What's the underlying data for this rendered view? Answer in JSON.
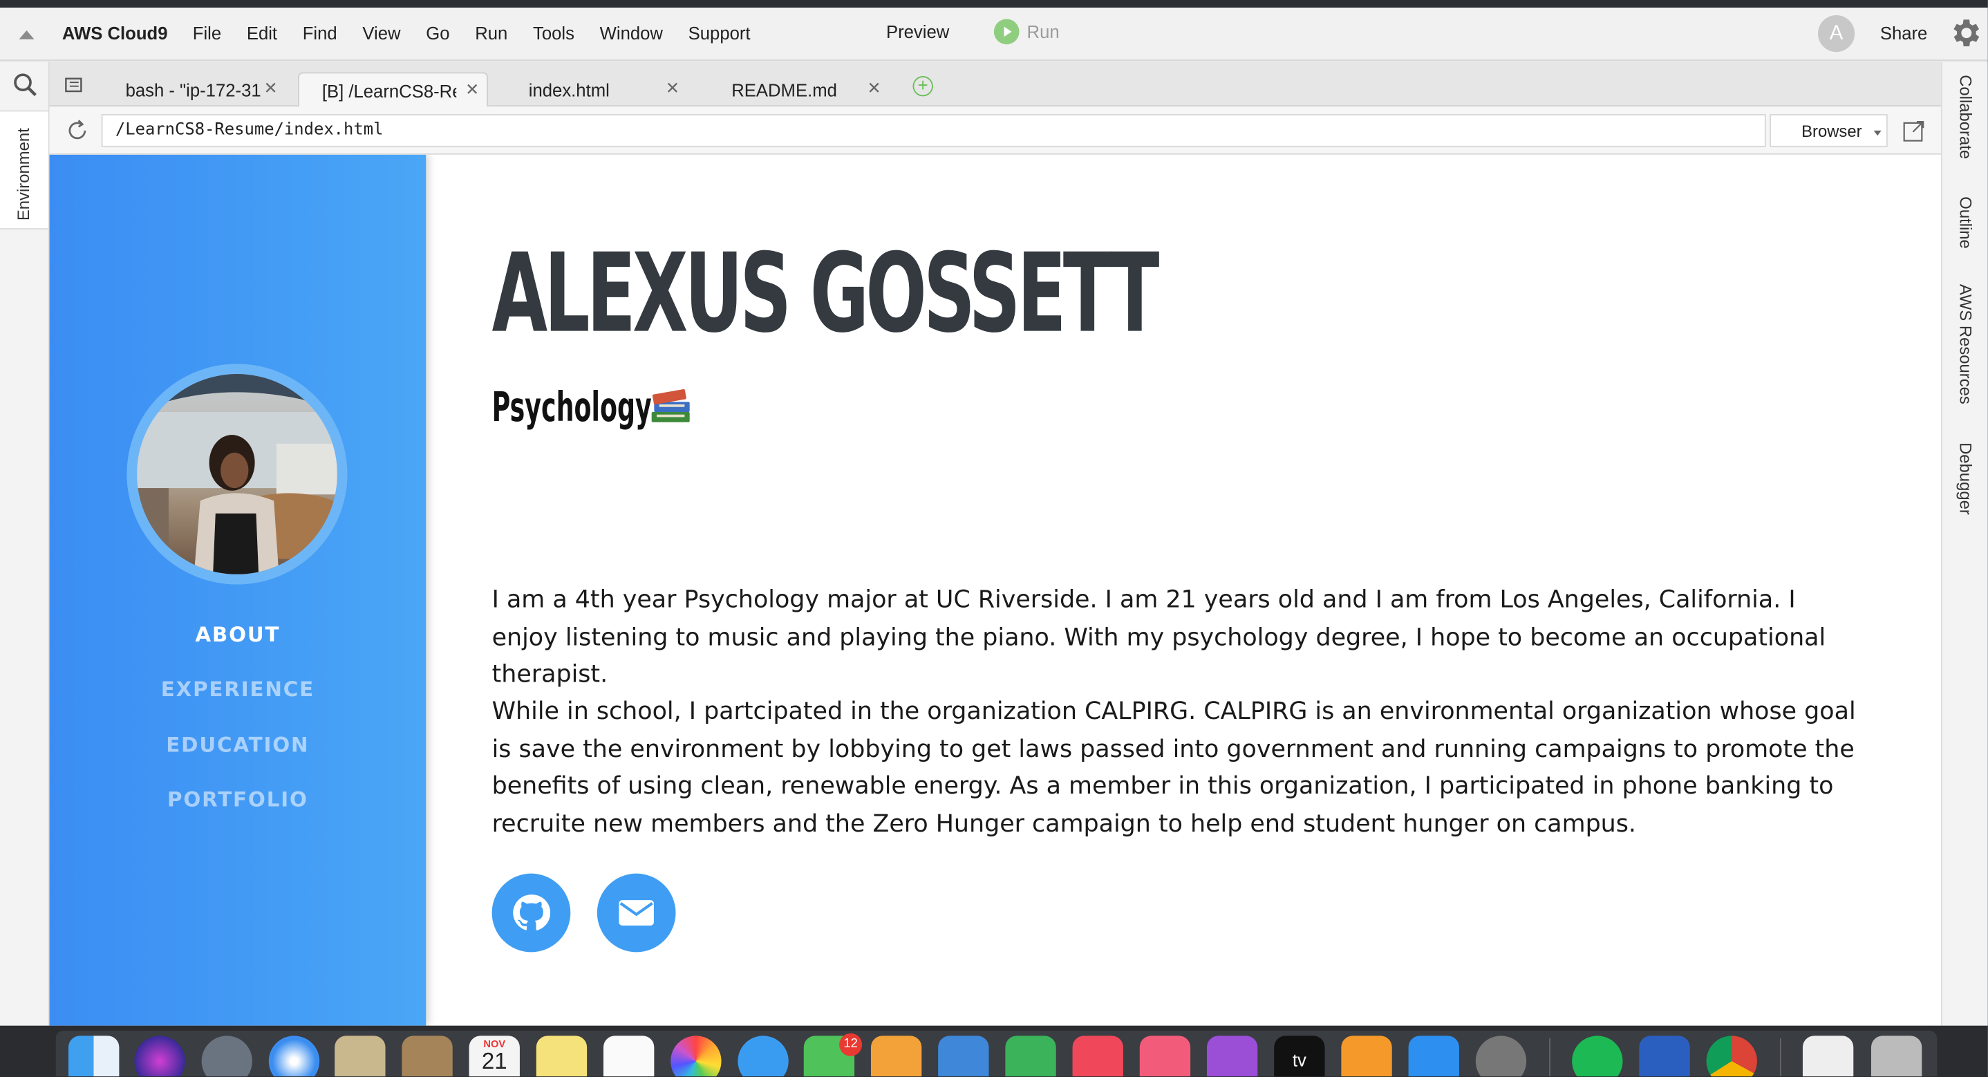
{
  "app": {
    "brand": "AWS Cloud9",
    "menu": [
      "File",
      "Edit",
      "Find",
      "View",
      "Go",
      "Run",
      "Tools",
      "Window",
      "Support"
    ],
    "preview_label": "Preview",
    "run_label": "Run",
    "avatar_initial": "A",
    "share_label": "Share"
  },
  "left_rail": {
    "environment_label": "Environment"
  },
  "right_rail": {
    "items": [
      "Collaborate",
      "Outline",
      "AWS Resources",
      "Debugger"
    ]
  },
  "tabs": [
    {
      "label": "bash - \"ip-172-31",
      "active": false
    },
    {
      "label": "[B] /LearnCS8-Re",
      "active": true
    },
    {
      "label": "index.html",
      "active": false
    },
    {
      "label": "README.md",
      "active": false
    }
  ],
  "address": {
    "url": "/LearnCS8-Resume/index.html",
    "browser_select": "Browser"
  },
  "resume": {
    "name": "ALEXUS GOSSETT",
    "subtitle": "Psychology",
    "nav": [
      "ABOUT",
      "EXPERIENCE",
      "EDUCATION",
      "PORTFOLIO"
    ],
    "active_nav": "ABOUT",
    "paragraph1": "I am a 4th year Psychology major at UC Riverside. I am 21 years old and I am from Los Angeles, California. I enjoy listening to music and playing the piano. With my psychology degree, I hope to become an occupational therapist.",
    "paragraph2": "While in school, I partcipated in the organization CALPIRG. CALPIRG is an environmental organization whose goal is save the environment by lobbying to get laws passed into government and running campaigns to promote the benefits of using clean, renewable energy. As a member in this organization, I participated in phone banking to recruite new members and the Zero Hunger campaign to help end student hunger on campus.",
    "social": [
      "github-icon",
      "envelope-icon"
    ]
  },
  "dock": {
    "calendar_month": "NOV",
    "calendar_day": "21",
    "facetime_badge": "12",
    "tv_label": "tv",
    "apps": [
      "finder",
      "siri",
      "launchpad",
      "safari",
      "mail",
      "contacts",
      "calendar",
      "notes",
      "reminders",
      "photos",
      "messages",
      "facetime",
      "pages",
      "keynote",
      "numbers",
      "news",
      "music",
      "podcasts",
      "tv",
      "books",
      "app-store",
      "system-preferences",
      "spotify",
      "word",
      "chrome",
      "downloads",
      "trash"
    ]
  },
  "colors": {
    "sidebar_gradient_start": "#3b8df3",
    "sidebar_gradient_end": "#4aa6f6",
    "heading": "#343a40",
    "social_button": "#3f9ef3",
    "run_green": "#8fce7f"
  }
}
